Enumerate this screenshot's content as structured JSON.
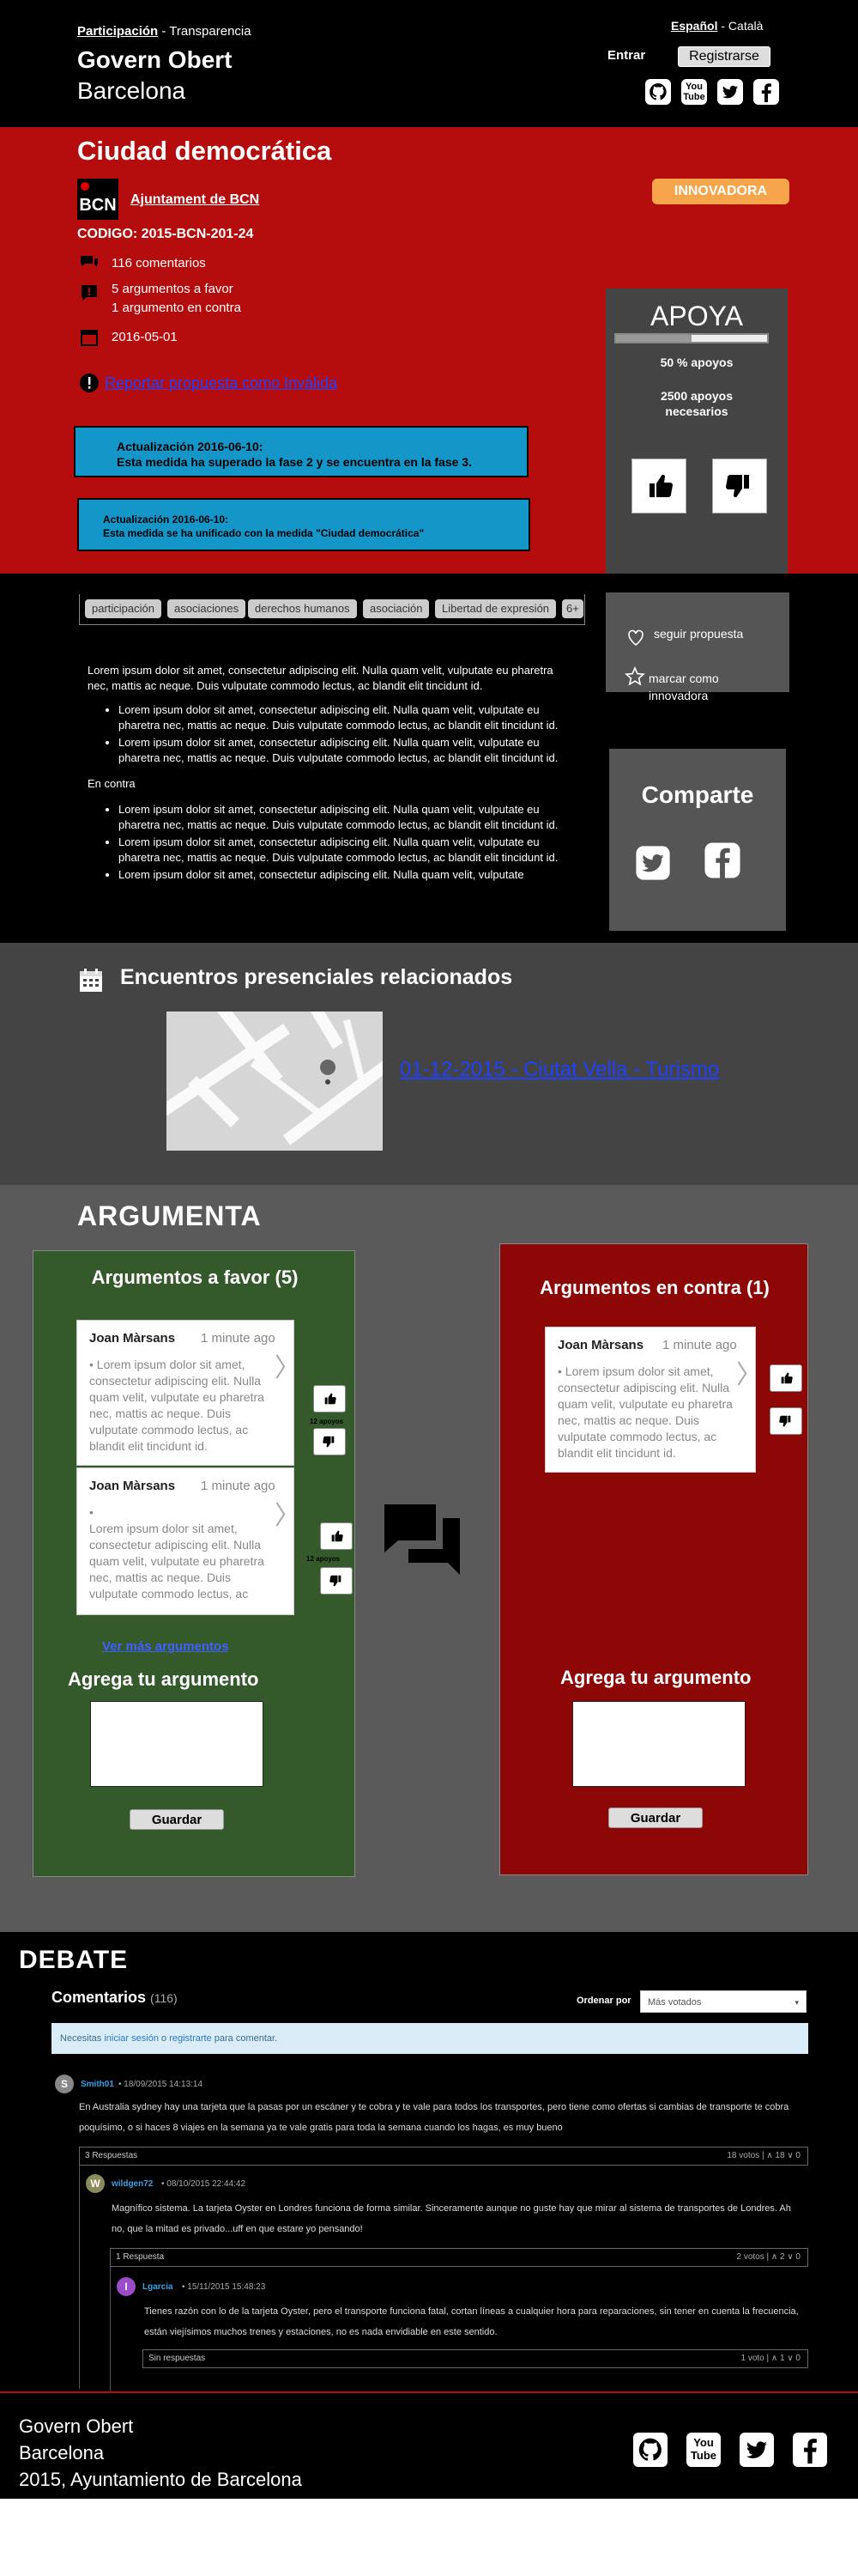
{
  "header": {
    "crumb_active": "Participación",
    "crumb_sep": " - ",
    "crumb_other": "Transparencia",
    "brand_line1": "Govern Obert",
    "brand_line2": "Barcelona",
    "lang_active": "Español",
    "lang_sep": " - ",
    "lang_other": "Català",
    "entrar": "Entrar",
    "registrarse": "Registrarse",
    "social": [
      "github-icon",
      "youtube-icon",
      "twitter-icon",
      "facebook-icon"
    ],
    "youtube_text": "You Tube"
  },
  "proposal": {
    "title": "Ciudad democrática",
    "logo_text": "BCN",
    "author_link": "Ajuntament de BCN",
    "codigo": "CODIGO: 2015-BCN-201-24",
    "comments": "116 comentarios",
    "args_favor": "5 argumentos a favor",
    "args_contra": "1 argumento en contra",
    "date": "2016-05-01",
    "report_link": "Reportar propuesta como Inválida",
    "badge": "INNOVADORA",
    "updates": [
      {
        "title": "Actualización 2016-06-10:",
        "text": "Esta medida ha superado la fase 2 y se encuentra en la fase 3."
      },
      {
        "title": "Actualización 2016-06-10:",
        "text": "Esta medida se ha unificado con la medida \"Ciudad democrática\""
      }
    ],
    "colors": {
      "red": "#b50d0d",
      "update_blue": "#1496c8",
      "badge_orange": "#f7a54a"
    }
  },
  "apoya": {
    "title": "APOYA",
    "progress": 0.5,
    "percent_text": "50 % apoyos",
    "needed_text": "2500 apoyos necesarios"
  },
  "tags": [
    "participación",
    "asociaciones",
    "derechos humanos",
    "asociación",
    "Libertad de expresión",
    "6+"
  ],
  "follow": {
    "seguir": "seguir propuesta",
    "marcar": "marcar como innovadora"
  },
  "share": {
    "title": "Comparte"
  },
  "description": {
    "intro": "Lorem ipsum dolor sit amet, consectetur adipiscing elit. Nulla quam velit, vulputate eu pharetra nec, mattis ac neque. Duis vulputate commodo lectus, ac blandit elit tincidunt id.",
    "favor_items": [
      "Lorem ipsum dolor sit amet, consectetur adipiscing elit. Nulla quam velit, vulputate eu pharetra nec, mattis ac neque. Duis vulputate commodo lectus, ac blandit elit tincidunt id.",
      "Lorem ipsum dolor sit amet, consectetur adipiscing elit. Nulla quam velit, vulputate eu pharetra nec, mattis ac neque. Duis vulputate commodo lectus, ac blandit elit tincidunt id."
    ],
    "contra_label": "En contra",
    "contra_items": [
      "Lorem ipsum dolor sit amet, consectetur adipiscing elit. Nulla quam velit, vulputate eu pharetra nec, mattis ac neque. Duis vulputate commodo lectus, ac blandit elit tincidunt id.",
      "Lorem ipsum dolor sit amet, consectetur adipiscing elit. Nulla quam velit, vulputate eu pharetra nec, mattis ac neque. Duis vulputate commodo lectus, ac blandit elit tincidunt id.",
      "Lorem ipsum dolor sit amet, consectetur adipiscing elit. Nulla quam velit, vulputate"
    ]
  },
  "encuentros": {
    "title": "Encuentros presenciales relacionados",
    "event_link": "01-12-2015 - Ciutat Vella - Turismo"
  },
  "argumenta": {
    "title": "ARGUMENTA",
    "favor": {
      "title": "Argumentos a favor (5)",
      "cards": [
        {
          "name": "Joan Màrsans",
          "time": "1 minute ago",
          "text": "Lorem ipsum dolor sit amet, consectetur adipiscing elit. Nulla quam velit, vulputate eu pharetra nec, mattis ac neque. Duis vulputate commodo lectus, ac blandit elit tincidunt id.",
          "votes": "12 apoyos"
        },
        {
          "name": "Joan Màrsans",
          "time": "1 minute ago",
          "text": "Lorem ipsum dolor sit amet, consectetur adipiscing elit. Nulla quam velit, vulputate eu pharetra nec, mattis ac neque. Duis vulputate commodo lectus, ac",
          "votes": "12 apoyos"
        }
      ],
      "more": "Ver más argumentos",
      "agrega": "Agrega tu argumento",
      "guardar": "Guardar"
    },
    "contra": {
      "title": "Argumentos en contra (1)",
      "cards": [
        {
          "name": "Joan Màrsans",
          "time": "1 minute ago",
          "text": "Lorem ipsum dolor sit amet, consectetur adipiscing elit. Nulla quam velit, vulputate eu pharetra nec, mattis ac neque. Duis vulputate commodo lectus, ac blandit elit tincidunt id."
        }
      ],
      "agrega": "Agrega tu argumento",
      "guardar": "Guardar"
    },
    "colors": {
      "favor_green": "#34592b",
      "contra_red": "#8d0707"
    }
  },
  "debate": {
    "title": "DEBATE",
    "comments_label": "Comentarios",
    "comments_count": "(116)",
    "order_label": "Ordenar por",
    "order_value": "Más votados",
    "login_prefix": "Necesitas ",
    "login_link": "iniciar sesión",
    "login_mid": " o ",
    "register_link": "registrarte",
    "login_suffix": " para comentar.",
    "comments": [
      {
        "avatar": "S",
        "user": "Smith01",
        "date": "• 18/09/2015 14:13:14",
        "text": "En Australia sydney hay una tarjeta que la pasas por un escáner y te cobra y te vale para todos los transportes, pero tiene como ofertas si cambias de transporte te cobra poquísimo, o si haces 8 viajes en la semana ya te vale gratis para toda la semana cuando los hagas, es muy bueno",
        "replies": "3 Respuestas",
        "votes": "18 votos | ∧ 18 ∨ 0"
      },
      {
        "avatar": "W",
        "user": "wildgen72",
        "date": "• 08/10/2015 22:44:42",
        "text": "Magnífico sistema. La tarjeta Oyster en Londres funciona de forma similar. Sinceramente aunque no guste hay que mirar al sistema de transportes de Londres. Ah no, que la mitad es privado...uff en que estare yo pensando!",
        "replies": "1 Respuesta",
        "votes": "2 votos | ∧ 2 ∨ 0"
      },
      {
        "avatar": "I",
        "user": "Lgarcia",
        "date": "• 15/11/2015 15:48:23",
        "text": "Tienes razón con lo de la tarjeta Oyster, pero el transporte funciona fatal, cortan líneas a cualquier hora para reparaciones, sin tener en cuenta la frecuencia, están viejísimos muchos trenes y estaciones, no es nada envidiable en este sentido.",
        "replies": "Sin respuestas",
        "votes": "1 voto | ∧ 1 ∨ 0"
      }
    ]
  },
  "footer": {
    "line1": "Govern Obert",
    "line2": "Barcelona",
    "line3": "2015, Ayuntamiento de Barcelona",
    "youtube_text": "You Tube"
  }
}
